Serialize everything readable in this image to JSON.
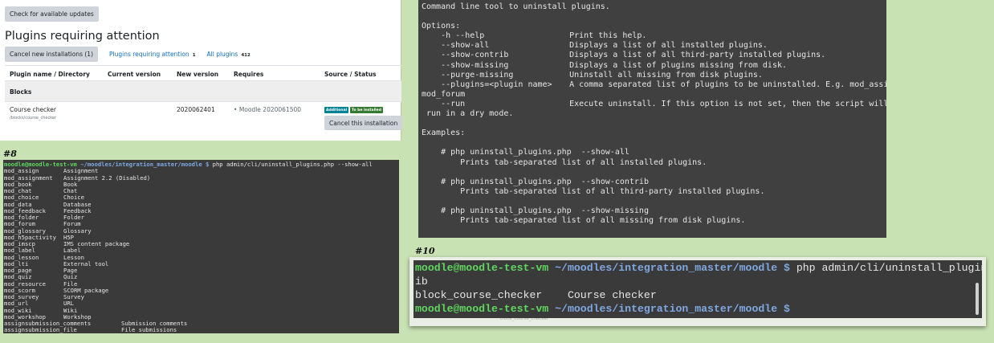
{
  "moodle": {
    "check_updates": "Check for available updates",
    "heading": "Plugins requiring attention",
    "filters": {
      "cancel_new": "Cancel new installations (1)",
      "requiring_attention": "Plugins requiring attention",
      "requiring_attention_count": "1",
      "all_plugins": "All plugins",
      "all_plugins_count": "412"
    },
    "columns": [
      "Plugin name / Directory",
      "Current version",
      "New version",
      "Requires",
      "Source / Status"
    ],
    "group": "Blocks",
    "row": {
      "name": "Course checker",
      "directory": "/blocks/course_checker",
      "new_version": "2020062401",
      "requires": "Moodle 2020061500",
      "badge_source": "Additional",
      "badge_status": "To be installed",
      "cancel_label": "Cancel this installation"
    }
  },
  "term8": {
    "label": "#8",
    "prompt_user": "moodle@moodle-test-vm",
    "prompt_path": "~/moodles/integration_master/moodle $",
    "command": "php admin/cli/uninstall_plugins.php --show-all",
    "rows": [
      {
        "name": "mod_assign",
        "desc": "Assignment"
      },
      {
        "name": "mod_assignment",
        "desc": "Assignment 2.2 (Disabled)"
      },
      {
        "name": "mod_book",
        "desc": "Book"
      },
      {
        "name": "mod_chat",
        "desc": "Chat"
      },
      {
        "name": "mod_choice",
        "desc": "Choice"
      },
      {
        "name": "mod_data",
        "desc": "Database"
      },
      {
        "name": "mod_feedback",
        "desc": "Feedback"
      },
      {
        "name": "mod_folder",
        "desc": "Folder"
      },
      {
        "name": "mod_forum",
        "desc": "Forum"
      },
      {
        "name": "mod_glossary",
        "desc": "Glossary"
      },
      {
        "name": "mod_h5pactivity",
        "desc": "H5P"
      },
      {
        "name": "mod_imscp",
        "desc": "IMS content package"
      },
      {
        "name": "mod_label",
        "desc": "Label"
      },
      {
        "name": "mod_lesson",
        "desc": "Lesson"
      },
      {
        "name": "mod_lti",
        "desc": "External tool"
      },
      {
        "name": "mod_page",
        "desc": "Page"
      },
      {
        "name": "mod_quiz",
        "desc": "Quiz"
      },
      {
        "name": "mod_resource",
        "desc": "File"
      },
      {
        "name": "mod_scorm",
        "desc": "SCORM package"
      },
      {
        "name": "mod_survey",
        "desc": "Survey"
      },
      {
        "name": "mod_url",
        "desc": "URL"
      },
      {
        "name": "mod_wiki",
        "desc": "Wiki"
      },
      {
        "name": "mod_workshop",
        "desc": "Workshop"
      }
    ],
    "wide_rows": [
      {
        "name": "assignsubmission_comments",
        "desc": "Submission comments"
      },
      {
        "name": "assignsubmission_file",
        "desc": "File submissions"
      }
    ]
  },
  "help": {
    "intro": "Command line tool to uninstall plugins.",
    "options_title": "Options:",
    "options": [
      {
        "flag": "-h --help",
        "desc": "Print this help."
      },
      {
        "flag": "--show-all",
        "desc": "Displays a list of all installed plugins."
      },
      {
        "flag": "--show-contrib",
        "desc": "Displays a list of all third-party installed plugins."
      },
      {
        "flag": "--show-missing",
        "desc": "Displays a list of plugins missing from disk."
      },
      {
        "flag": "--purge-missing",
        "desc": "Uninstall all missing from disk plugins."
      },
      {
        "flag": "--plugins=<plugin name>",
        "desc": "A comma separated list of plugins to be uninstalled. E.g. mod_assign,"
      }
    ],
    "plugins_wrap": "mod_forum",
    "run_flag": "--run",
    "run_desc": "Execute uninstall. If this option is not set, then the script will be",
    "run_wrap": " run in a dry mode.",
    "examples_title": "Examples:",
    "examples": [
      {
        "cmd": "# php uninstall_plugins.php  --show-all",
        "desc": "Prints tab-separated list of all installed plugins."
      },
      {
        "cmd": "# php uninstall_plugins.php  --show-contrib",
        "desc": "Prints tab-separated list of all third-party installed plugins."
      },
      {
        "cmd": "# php uninstall_plugins.php  --show-missing",
        "desc": "Prints tab-separated list of all missing from disk plugins."
      }
    ]
  },
  "term10": {
    "label": "#10",
    "prompt_user": "moodle@moodle-test-vm",
    "prompt_path": "~/moodles/integration_master/moodle $",
    "command": "php admin/cli/uninstall_plugins.php --show-contr",
    "command_wrap": "ib",
    "output_name": "block_course_checker",
    "output_desc": "Course checker",
    "ghost_text": "block_course_checker"
  }
}
